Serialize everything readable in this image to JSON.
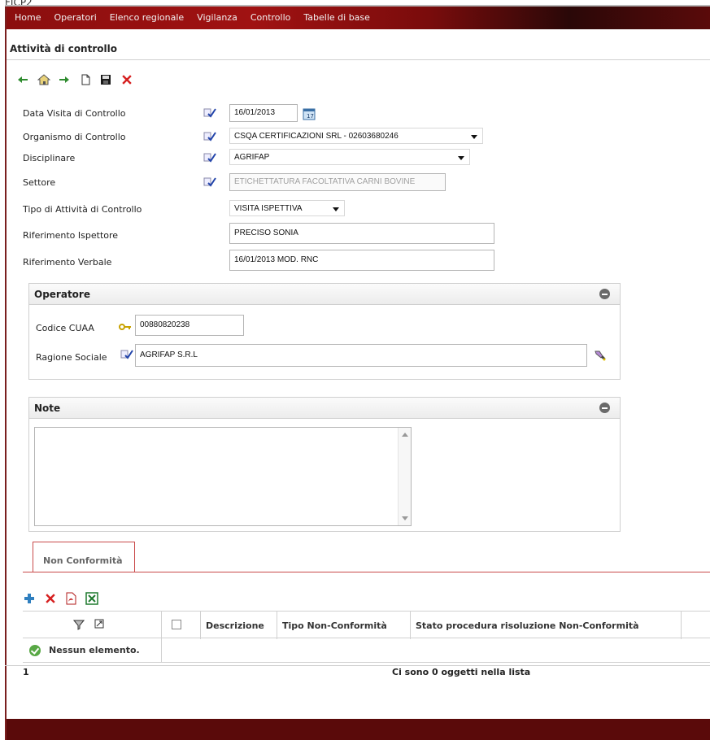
{
  "app_label": "FICP2",
  "menu": {
    "items": [
      {
        "label": "Home"
      },
      {
        "label": "Operatori"
      },
      {
        "label": "Elenco regionale"
      },
      {
        "label": "Vigilanza"
      },
      {
        "label": "Controllo"
      },
      {
        "label": "Tabelle di base"
      }
    ]
  },
  "page": {
    "title": "Attività di controllo"
  },
  "toolbar": {
    "icons": [
      "back-arrow-icon",
      "home-icon",
      "forward-arrow-icon",
      "new-document-icon",
      "save-icon",
      "delete-icon"
    ]
  },
  "form": {
    "data_visita": {
      "label": "Data Visita di Controllo",
      "value": "16/01/2013"
    },
    "organismo": {
      "label": "Organismo di Controllo",
      "value": "CSQA CERTIFICAZIONI SRL - 02603680246"
    },
    "disciplinare": {
      "label": "Disciplinare",
      "value": "AGRIFAP"
    },
    "settore": {
      "label": "Settore",
      "value": "ETICHETTATURA FACOLTATIVA CARNI BOVINE"
    },
    "tipo_attivita": {
      "label": "Tipo di Attività di Controllo",
      "value": "VISITA ISPETTIVA"
    },
    "rif_ispettore": {
      "label": "Riferimento Ispettore",
      "value": "PRECISO SONIA"
    },
    "rif_verbale": {
      "label": "Riferimento Verbale",
      "value": "16/01/2013 MOD. RNC"
    }
  },
  "operatore": {
    "title": "Operatore",
    "cuaa": {
      "label": "Codice CUAA",
      "value": "00880820238"
    },
    "ragione_sociale": {
      "label": "Ragione Sociale",
      "value": "AGRIFAP S.R.L"
    }
  },
  "note": {
    "title": "Note",
    "value": ""
  },
  "tabs": [
    {
      "label": "Non Conformità",
      "active": true
    }
  ],
  "table": {
    "columns": [
      {
        "label": ""
      },
      {
        "label": ""
      },
      {
        "label": "Descrizione"
      },
      {
        "label": "Tipo Non-Conformità"
      },
      {
        "label": "Stato procedura risoluzione Non-Conformità"
      }
    ],
    "empty_message": "Nessun elemento.",
    "page_number": "1",
    "count_message": "Ci sono 0 oggetti nella lista"
  },
  "colors": {
    "menu_bar": "#8b0e0e",
    "footer": "#5a0a0a",
    "tab_border": "#c94a4a",
    "success": "#58a845"
  }
}
